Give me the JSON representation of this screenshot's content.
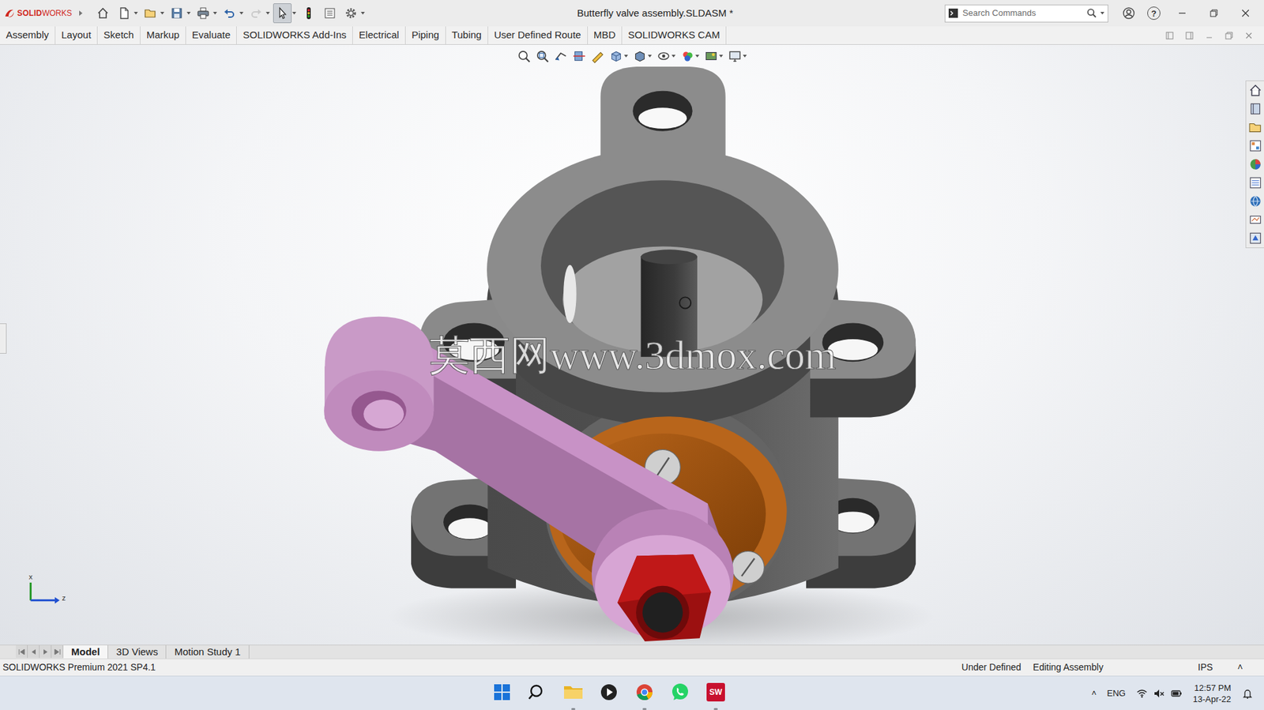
{
  "app_logo": {
    "bold": "SOLID",
    "light": "WORKS"
  },
  "window": {
    "title": "Butterfly valve assembly.SLDASM *"
  },
  "quick_access": [
    {
      "kind": "home",
      "pressed": false,
      "disabled": false,
      "menu": false
    },
    {
      "kind": "new",
      "pressed": false,
      "disabled": false,
      "menu": true
    },
    {
      "kind": "open",
      "pressed": false,
      "disabled": false,
      "menu": true
    },
    {
      "kind": "save",
      "pressed": false,
      "disabled": false,
      "menu": true
    },
    {
      "kind": "print",
      "pressed": false,
      "disabled": false,
      "menu": true
    },
    {
      "kind": "undo",
      "pressed": false,
      "disabled": false,
      "menu": true
    },
    {
      "kind": "redo",
      "pressed": false,
      "disabled": true,
      "menu": true
    },
    {
      "kind": "select",
      "pressed": true,
      "disabled": false,
      "menu": true
    },
    {
      "kind": "rebuild",
      "pressed": false,
      "disabled": false,
      "menu": false
    },
    {
      "kind": "fileprops",
      "pressed": false,
      "disabled": false,
      "menu": false
    },
    {
      "kind": "options",
      "pressed": false,
      "disabled": false,
      "menu": true
    }
  ],
  "search": {
    "placeholder": "Search Commands"
  },
  "help": {
    "label": "?"
  },
  "ribbon_tabs": [
    {
      "label": "Assembly",
      "selected": false
    },
    {
      "label": "Layout",
      "selected": false
    },
    {
      "label": "Sketch",
      "selected": false
    },
    {
      "label": "Markup",
      "selected": false
    },
    {
      "label": "Evaluate",
      "selected": false
    },
    {
      "label": "SOLIDWORKS Add-Ins",
      "selected": false
    },
    {
      "label": "Electrical",
      "selected": false
    },
    {
      "label": "Piping",
      "selected": false
    },
    {
      "label": "Tubing",
      "selected": false
    },
    {
      "label": "User Defined Route",
      "selected": false
    },
    {
      "label": "MBD",
      "selected": false
    },
    {
      "label": "SOLIDWORKS CAM",
      "selected": false
    }
  ],
  "viewport": {
    "watermark": "莫西网www.3dmox.com",
    "triad": {
      "x": "x",
      "z": "z"
    }
  },
  "bottom_tabs": [
    {
      "label": "Model",
      "selected": true
    },
    {
      "label": "3D Views",
      "selected": false
    },
    {
      "label": "Motion Study 1",
      "selected": false
    }
  ],
  "status_bar": {
    "product": "SOLIDWORKS Premium 2021 SP4.1",
    "items": [
      "Under Defined",
      "Editing Assembly",
      "IPS"
    ],
    "toggle": "˄"
  },
  "taskbar": {
    "apps": [
      {
        "kind": "start",
        "running": false
      },
      {
        "kind": "search",
        "running": false
      },
      {
        "kind": "explorer",
        "running": true
      },
      {
        "kind": "media",
        "running": false
      },
      {
        "kind": "chrome",
        "running": true
      },
      {
        "kind": "whatsapp",
        "running": false
      },
      {
        "kind": "solidworks",
        "running": true,
        "label": "SW"
      }
    ],
    "tray": {
      "overflow": "˄",
      "language": "ENG",
      "muted": true,
      "time": "12:57 PM",
      "date": "13-Apr-22"
    }
  }
}
